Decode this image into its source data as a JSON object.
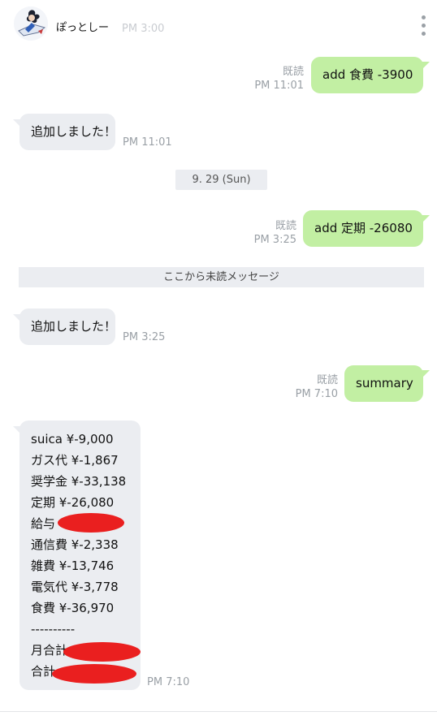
{
  "header": {
    "contact_name": "ぽっとしー",
    "ghost_time": "PM 3:00",
    "menu_icon": "vertical-ellipsis-icon"
  },
  "messages": {
    "m1": {
      "text": "add 食費 -3900",
      "read": "既読",
      "time": "PM 11:01"
    },
    "m2": {
      "text": "追加しました！",
      "time": "PM 11:01"
    },
    "date_separator": "9. 29 (Sun)",
    "m3": {
      "text": "add 定期 -26080",
      "read": "既読",
      "time": "PM 3:25"
    },
    "unread_divider": "ここから未読メッセージ",
    "m4": {
      "text": "追加しました！",
      "time": "PM 3:25"
    },
    "m5": {
      "text": "summary",
      "read": "既読",
      "time": "PM 7:10"
    },
    "m6": {
      "lines": [
        "suica ¥-9,000",
        "ガス代 ¥-1,867",
        "奨学金 ¥-33,138",
        "定期 ¥-26,080",
        "給与",
        "通信費 ¥-2,338",
        "雑費 ¥-13,746",
        "電気代 ¥-3,778",
        "食費 ¥-36,970",
        "----------",
        "月合計",
        "合計"
      ],
      "time": "PM 7:10"
    }
  },
  "colors": {
    "incoming_bubble": "#ebedf1",
    "outgoing_bubble": "#c2efa3",
    "meta_text": "#9aa0a6",
    "redaction": "#ea1f1f"
  }
}
